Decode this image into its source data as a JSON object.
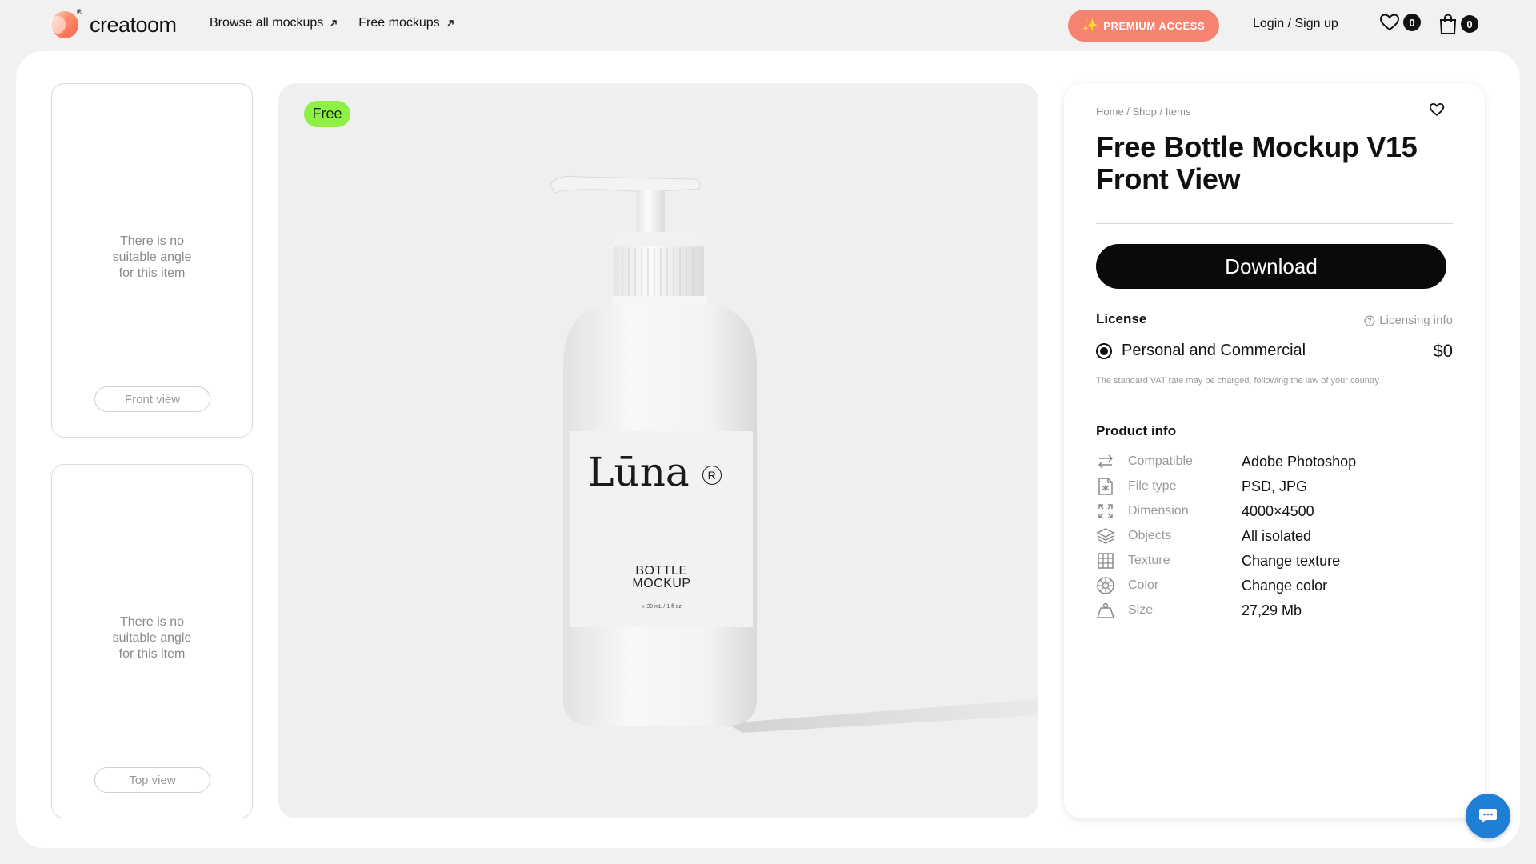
{
  "brand": {
    "name": "creatoom",
    "reg_mark": "®"
  },
  "nav": {
    "items": [
      {
        "label": "Browse all mockups",
        "icon": "arrow-up-right-icon"
      },
      {
        "label": "Free mockups",
        "icon": "arrow-up-right-icon"
      }
    ]
  },
  "header": {
    "premium_label": "PREMIUM ACCESS",
    "premium_icon": "sparkle-icon",
    "login_label": "Login / Sign up",
    "wishlist_count": "0",
    "cart_count": "0",
    "accent_color": "#f4836f"
  },
  "thumbnails": [
    {
      "message_lines": [
        "There is no",
        "suitable angle",
        "for this item"
      ],
      "button_label": "Front view"
    },
    {
      "message_lines": [
        "There is no",
        "suitable angle",
        "for this item"
      ],
      "button_label": "Top view"
    }
  ],
  "preview": {
    "badge": "Free",
    "badge_color": "#8ef045",
    "product_label": {
      "brand": "Lūna",
      "reg": "R",
      "line1": "BOTTLE",
      "line2": "MOCKUP",
      "volume": "℮ 30 mL / 1 fl oz"
    }
  },
  "product": {
    "breadcrumb": "Home / Shop / Items",
    "title": "Free Bottle Mockup V15 Front View",
    "download_label": "Download",
    "license_label": "License",
    "licensing_info_label": "Licensing info",
    "license_option": "Personal and Commercial",
    "price": "$0",
    "vat_note": "The standard VAT rate may be charged, following the law of your country",
    "info_title": "Product info",
    "info": [
      {
        "icon": "swap-arrows-icon",
        "key": "Compatible",
        "value": "Adobe Photoshop"
      },
      {
        "icon": "file-icon",
        "key": "File type",
        "value": "PSD, JPG"
      },
      {
        "icon": "expand-icon",
        "key": "Dimension",
        "value": "4000×4500"
      },
      {
        "icon": "layers-icon",
        "key": "Objects",
        "value": "All isolated"
      },
      {
        "icon": "grid-icon",
        "key": "Texture",
        "value": "Change texture"
      },
      {
        "icon": "color-wheel-icon",
        "key": "Color",
        "value": "Change color"
      },
      {
        "icon": "weight-icon",
        "key": "Size",
        "value": "27,29 Mb"
      }
    ]
  },
  "chat": {
    "icon": "chat-icon",
    "color": "#1f7ed6"
  }
}
